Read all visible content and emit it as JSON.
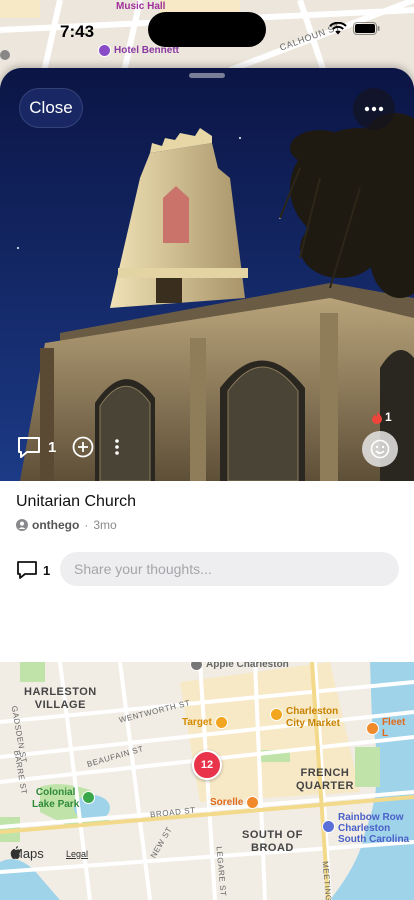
{
  "status": {
    "time": "7:43"
  },
  "map_top": {
    "labels": [
      "Music Hall",
      "Hotel Bennett",
      "CALHOUN ST"
    ]
  },
  "post": {
    "close_label": "Close",
    "comment_count": "1",
    "reaction_count": "1",
    "title": "Unitarian Church",
    "author": "onthego",
    "age": "3mo",
    "comments_count": "1",
    "input_placeholder": "Share your thoughts..."
  },
  "map_bottom": {
    "neighborhoods": [
      "HARLESTON\nVILLAGE",
      "FRENCH\nQUARTER",
      "SOUTH OF\nBROAD"
    ],
    "streets": [
      "WENTWORTH ST",
      "BEAUFAIN ST",
      "BROAD ST",
      "GADSDEN ST",
      "BARRE ST",
      "NEW ST",
      "LEGARE ST",
      "MEETING ST"
    ],
    "pois": [
      "Apple Charleston",
      "Target",
      "Charleston\nCity Market",
      "Fleet L",
      "Colonial\nLake Park",
      "Sorelle",
      "Rainbow Row\nCharleston\nSouth Carolina"
    ],
    "cluster_count": "12",
    "maps_label": "Maps",
    "legal_label": "Legal"
  },
  "colors": {
    "sky": "#101b52",
    "cluster": "#e8334a",
    "park": "#bfe3a8",
    "water": "#9fd3ea"
  }
}
